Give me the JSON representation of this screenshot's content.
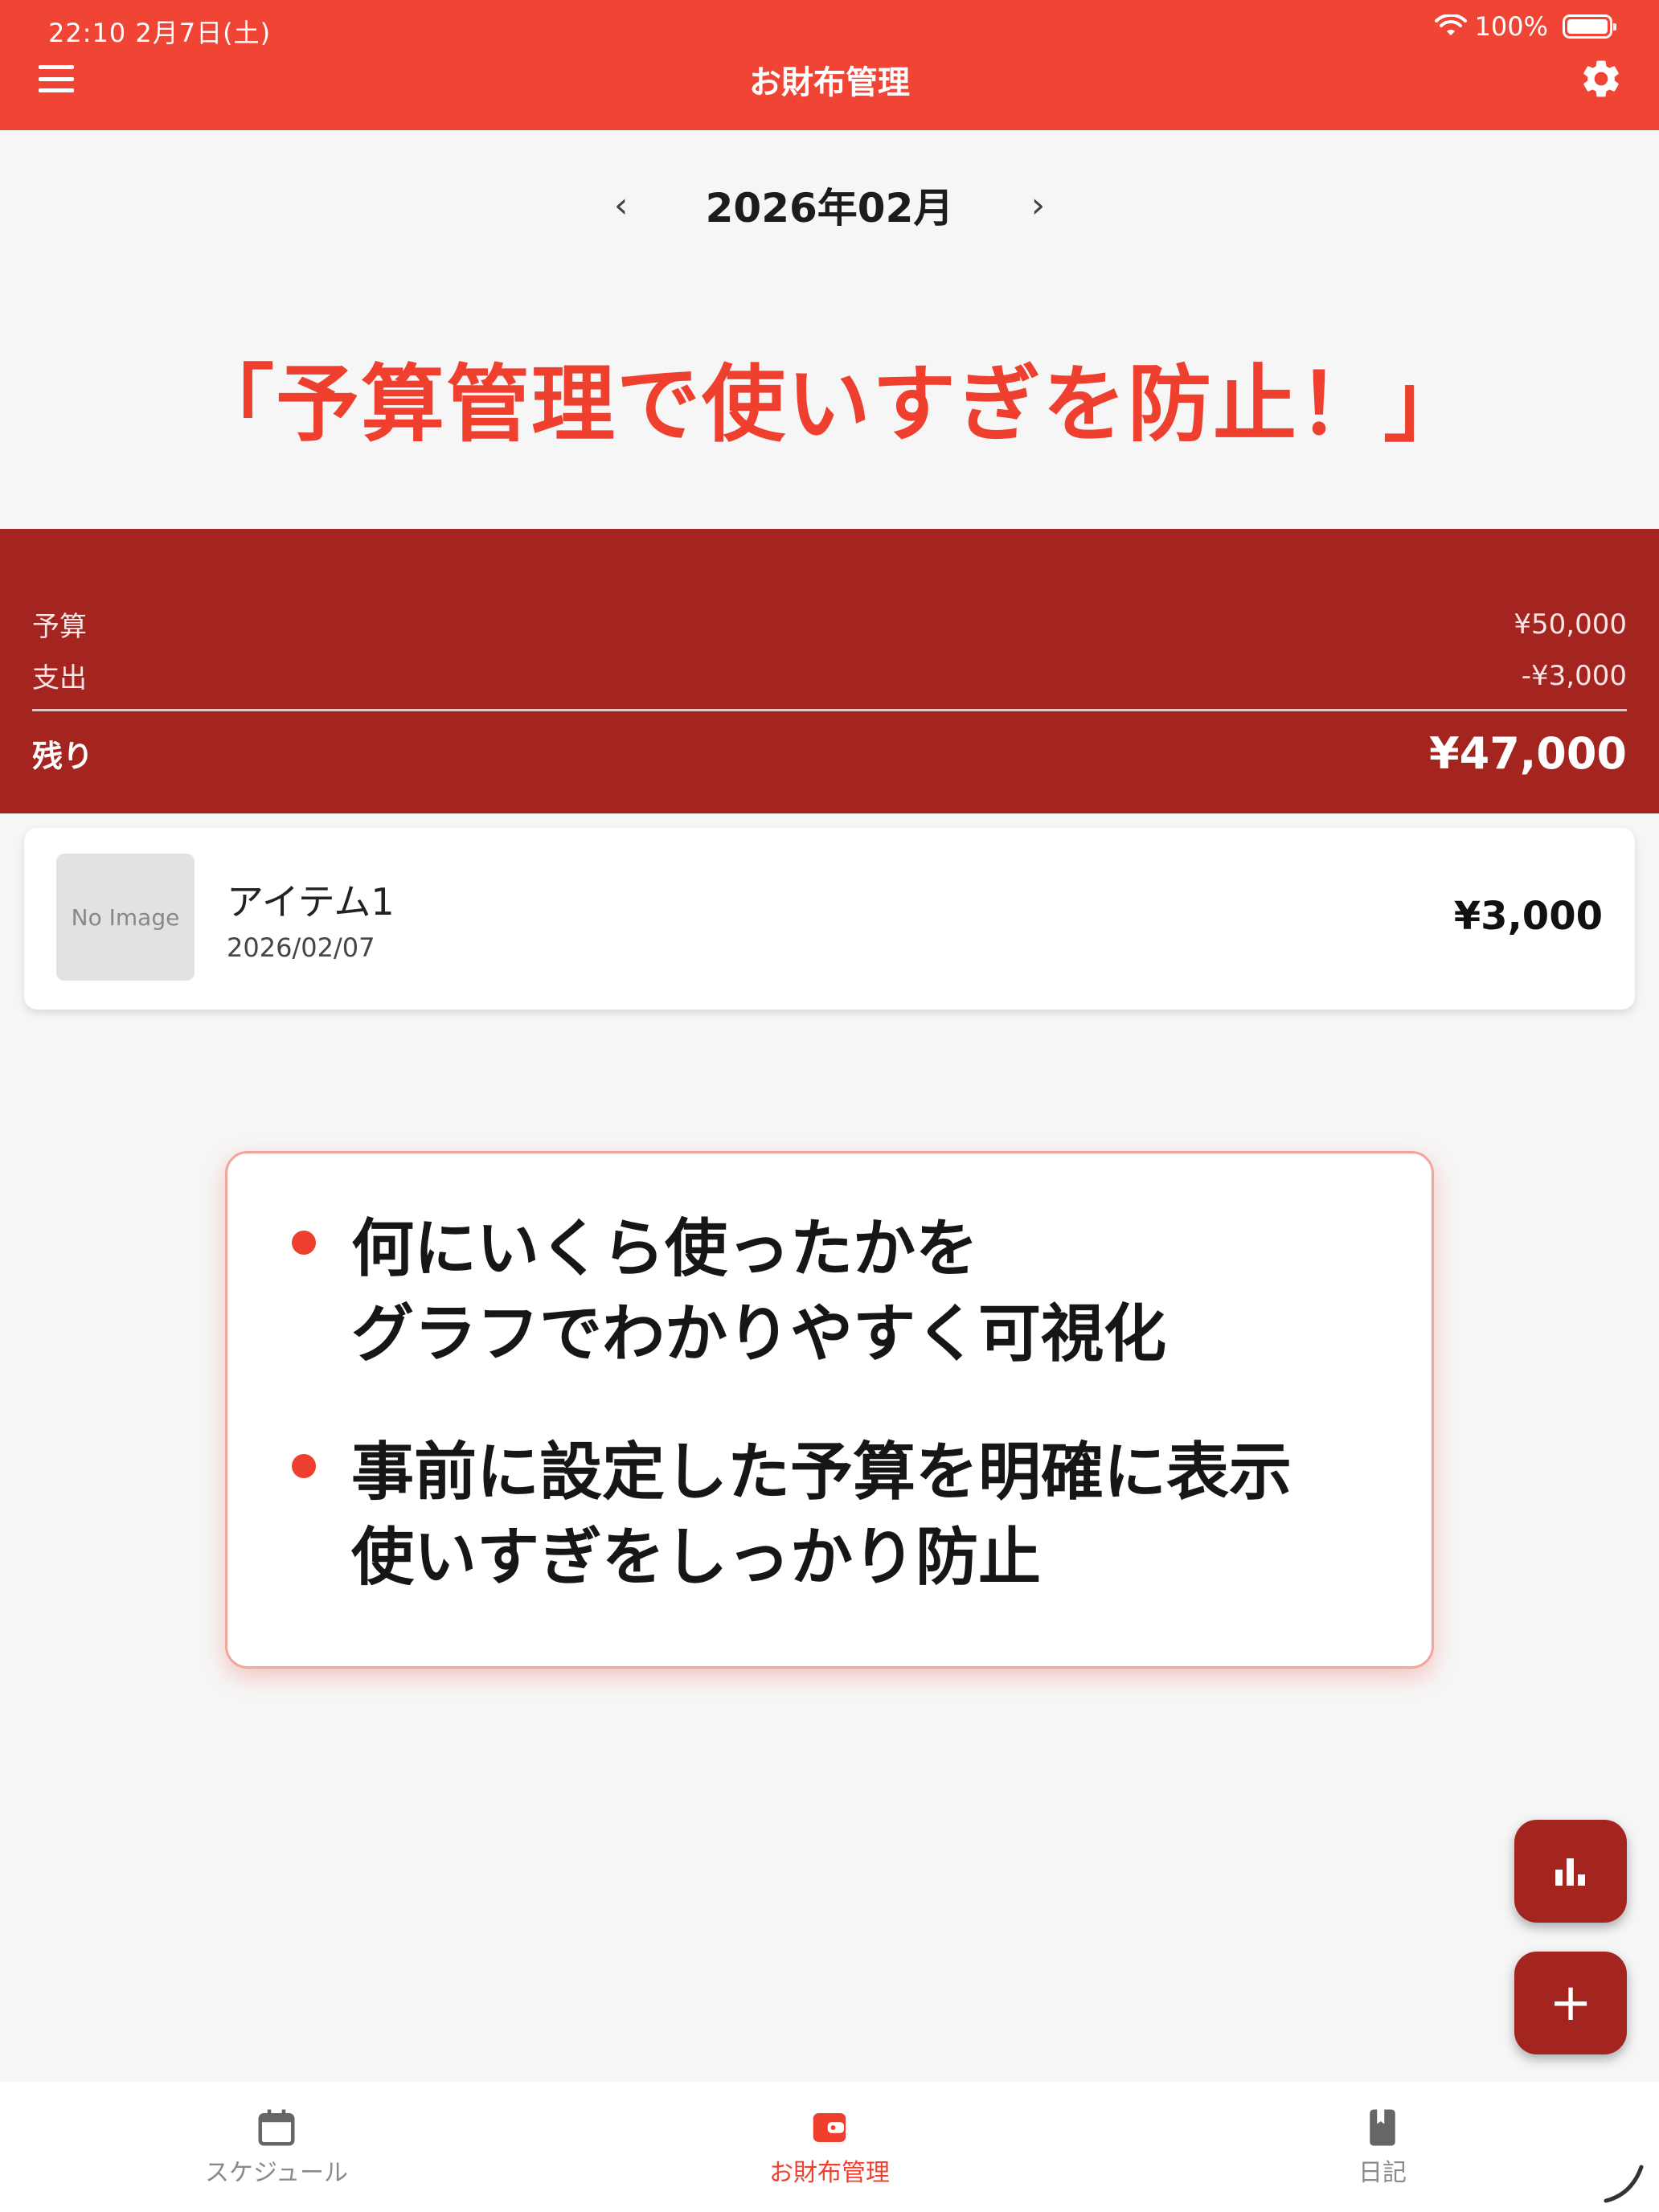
{
  "status_bar": {
    "time_date": "22:10  2月7日(土)",
    "battery": "100%"
  },
  "app_bar": {
    "title": "お財布管理"
  },
  "month": {
    "label": "2026年02月",
    "prev": "‹",
    "next": "›"
  },
  "promo": {
    "headline": "「予算管理で使いすぎを防止！」"
  },
  "summary": {
    "budget_label": "予算",
    "budget_value": "¥50,000",
    "expense_label": "支出",
    "expense_value": "-¥3,000",
    "remaining_label": "残り",
    "remaining_value": "¥47,000"
  },
  "items": [
    {
      "thumbnail_text": "No Image",
      "name": "アイテム1",
      "date": "2026/02/07",
      "amount": "¥3,000"
    }
  ],
  "features": {
    "bullet1_line1": "何にいくら使ったかを",
    "bullet1_line2": "グラフでわかりやすく可視化",
    "bullet2_line1": "事前に設定した予算を明確に表示",
    "bullet2_line2": "使いすぎをしっかり防止"
  },
  "fabs": {
    "chart_icon": "bar-chart-icon",
    "add_label": "+"
  },
  "bottom_nav": [
    {
      "label": "スケジュール",
      "icon": "calendar-icon",
      "active": false
    },
    {
      "label": "お財布管理",
      "icon": "wallet-icon",
      "active": true
    },
    {
      "label": "日記",
      "icon": "book-icon",
      "active": false
    }
  ],
  "colors": {
    "primary": "#f04435",
    "dark_red": "#a42420",
    "accent_text": "#ef3f2f"
  }
}
